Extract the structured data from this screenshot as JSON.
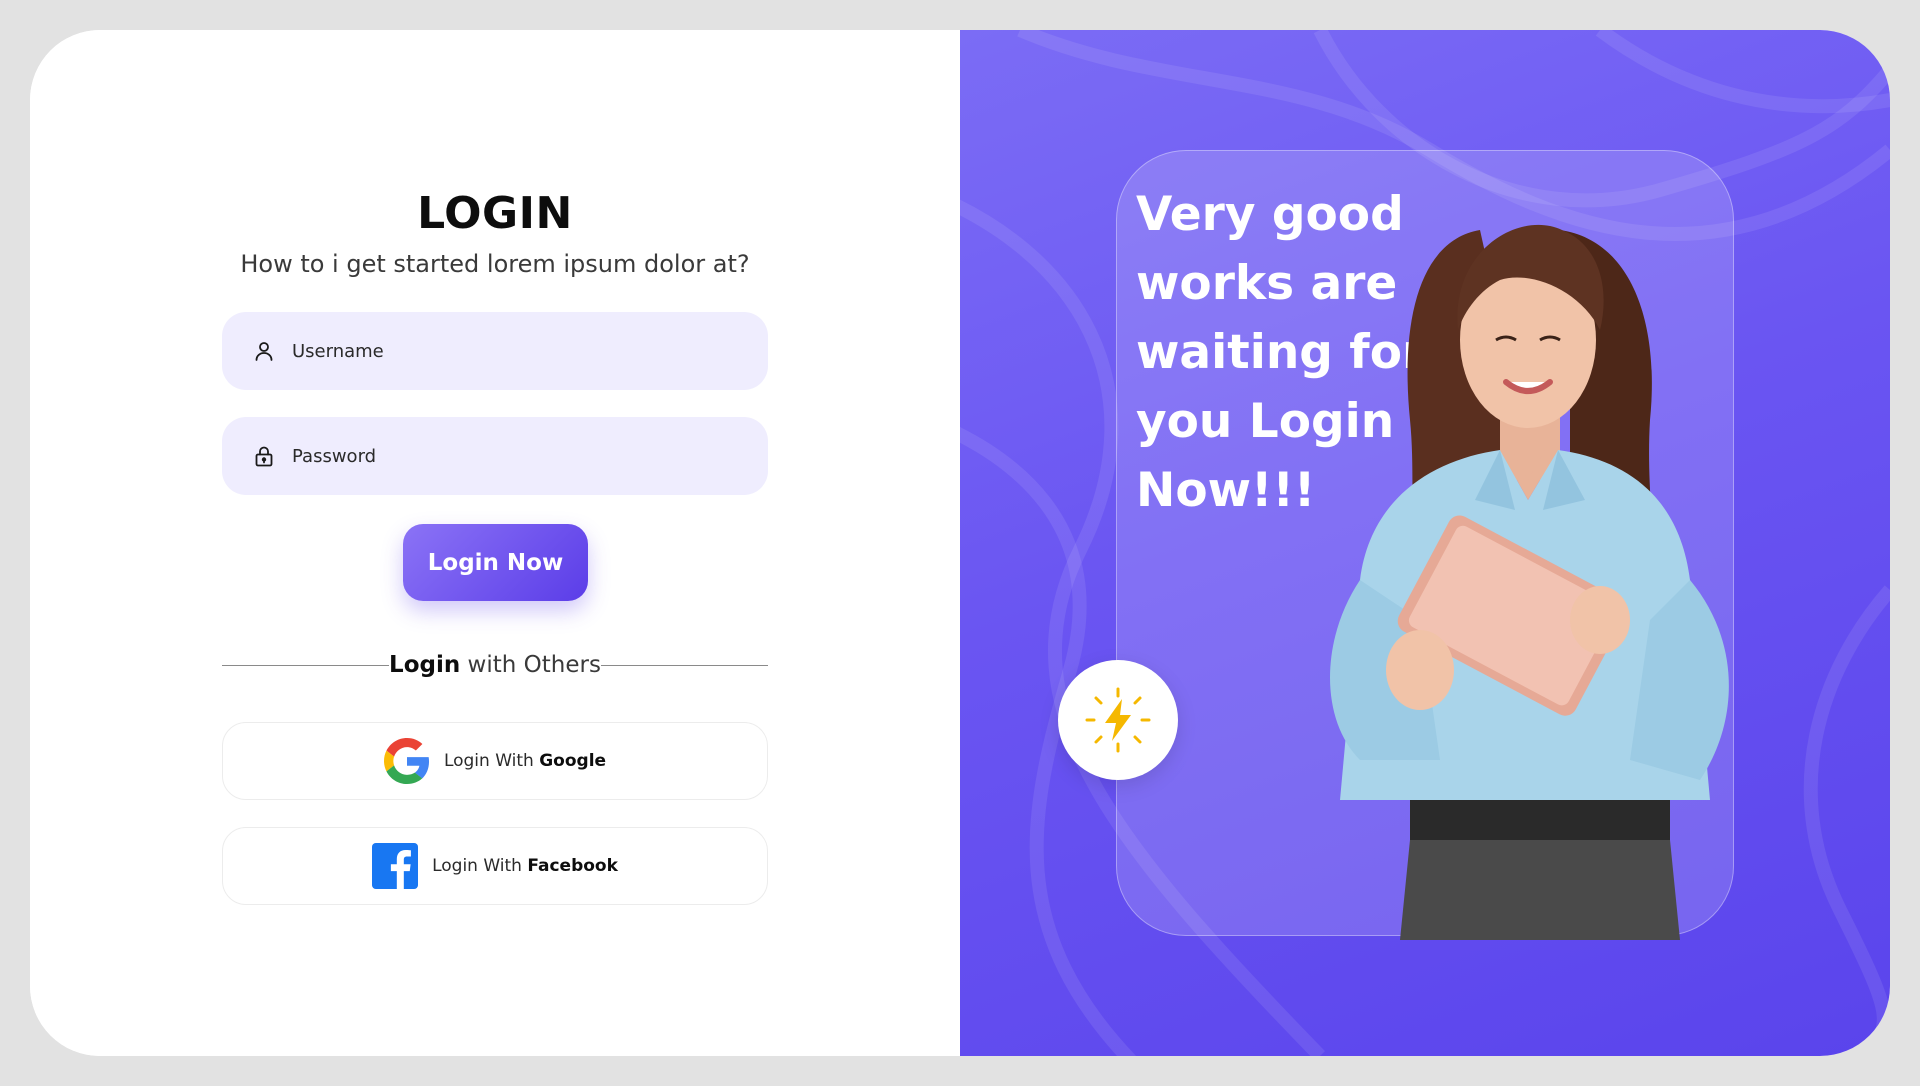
{
  "login": {
    "title": "LOGIN",
    "subtitle": "How to i get started lorem ipsum dolor at?",
    "username_placeholder": "Username",
    "password_placeholder": "Password",
    "submit_label": "Login Now",
    "divider_bold": "Login",
    "divider_rest": " with Others",
    "google": {
      "prefix": "Login With ",
      "brand": "Google"
    },
    "facebook": {
      "prefix": "Login With ",
      "brand": "Facebook"
    }
  },
  "promo": {
    "headline": "Very good works are waiting for you Login Now!!!"
  },
  "icons": {
    "username": "user-icon",
    "password": "lock-icon",
    "google": "google-logo-icon",
    "facebook": "facebook-logo-icon",
    "badge": "lightning-flash-icon"
  },
  "colors": {
    "accent": "#6a55f2",
    "accent_light": "#8b73f6",
    "field_bg": "#efedfe",
    "facebook_blue": "#1877f2",
    "flash_yellow": "#f5b800"
  }
}
